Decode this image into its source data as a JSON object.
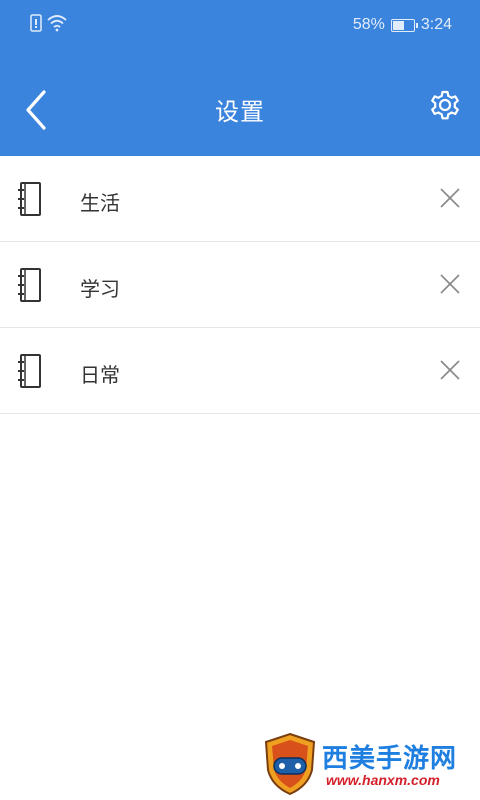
{
  "status_bar": {
    "battery_percent": "58%",
    "battery_level": 0.58,
    "time": "3:24"
  },
  "header": {
    "title": "设置",
    "back_icon": "chevron-left-icon",
    "settings_icon": "gear-icon"
  },
  "colors": {
    "app_bar": "#3b84de",
    "divider": "#e6e6e6",
    "label": "#333333"
  },
  "notebooks": [
    {
      "label": "生活",
      "icon": "notebook-icon",
      "delete_icon": "close-icon"
    },
    {
      "label": "学习",
      "icon": "notebook-icon",
      "delete_icon": "close-icon"
    },
    {
      "label": "日常",
      "icon": "notebook-icon",
      "delete_icon": "close-icon"
    }
  ],
  "watermark": {
    "title": "西美手游网",
    "url": "www.hanxm.com"
  }
}
